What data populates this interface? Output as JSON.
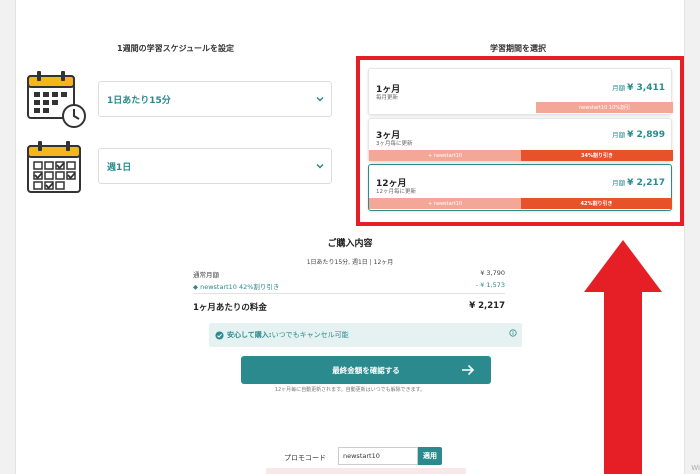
{
  "schedule": {
    "title": "1週間の学習スケジュールを設定",
    "time_select": "1日あたり15分",
    "freq_select": "週1日"
  },
  "plans": {
    "title": "学習期間を選択",
    "price_prefix": "月額",
    "items": [
      {
        "name": "1ヶ月",
        "sub": "毎月更新",
        "price": "¥ 3,411",
        "bar_left": "",
        "bar_right": "newstart10 10%割引",
        "selected": false
      },
      {
        "name": "3ヶ月",
        "sub": "3ヶ月毎に更新",
        "price": "¥ 2,899",
        "bar_left": "+ newstart10",
        "bar_right": "34%割り引き",
        "selected": false
      },
      {
        "name": "12ヶ月",
        "sub": "12ヶ月毎に更新",
        "price": "¥ 2,217",
        "bar_left": "+ newstart10",
        "bar_right": "42%割り引き",
        "selected": true
      }
    ]
  },
  "summary": {
    "title": "ご購入内容",
    "subtitle": "1日あたり15分, 週1日 | 12ヶ月",
    "regular_label": "通常月額",
    "regular_value": "¥ 3,790",
    "discount_label": "newstart10  42%割り引き",
    "discount_value": "- ¥ 1,573",
    "total_label": "1ヶ月あたりの料金",
    "total_value": "¥ 2,217"
  },
  "notice": {
    "strong": "安心して購入:",
    "text": "いつでもキャンセル可能"
  },
  "cta": {
    "label": "最終金額を確認する",
    "note": "12ヶ月毎に自動更新されます。自動更新はいつでも解除できます。"
  },
  "promo": {
    "label": "プロモコード",
    "value": "newstart10",
    "button": "適用"
  },
  "window": {
    "edge_label": "Wi"
  },
  "colors": {
    "accent": "#2a8a8d",
    "discount": "#e8522b",
    "discount_light": "#f2a797",
    "highlight": "#e61e25"
  }
}
